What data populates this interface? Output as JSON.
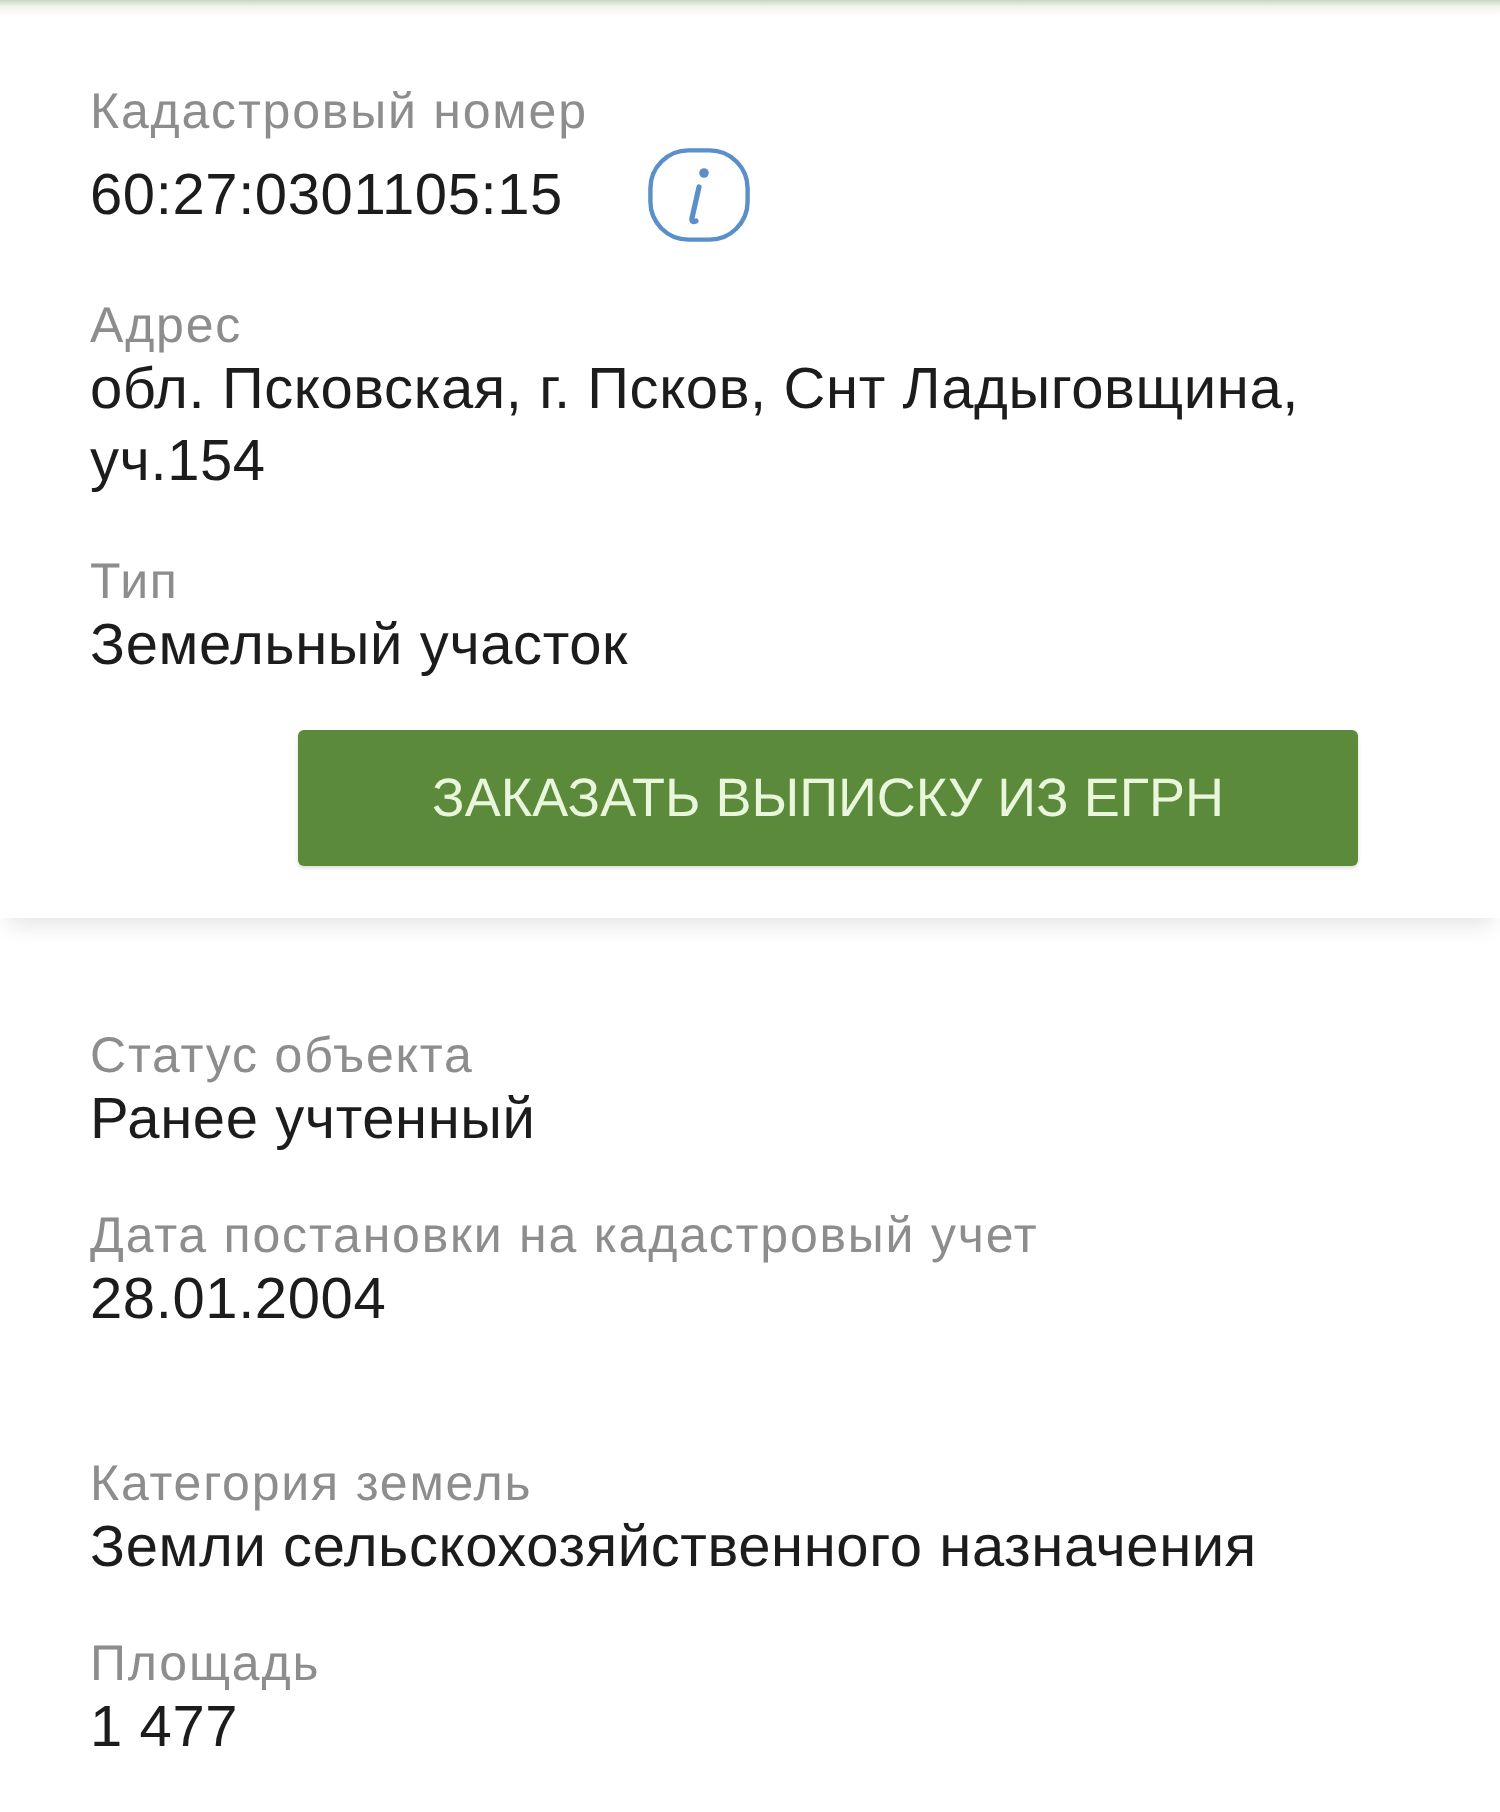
{
  "object_card": {
    "fields": [
      {
        "label": "Кадастровый номер",
        "value": "60:27:0301105:15",
        "info_button": true
      },
      {
        "label": "Адрес",
        "value": "обл. Псковская, г. Псков, Снт Ладыговщина, уч.154",
        "info_button": false
      },
      {
        "label": "Тип",
        "value": "Земельный участок",
        "info_button": false
      }
    ],
    "order_button": "ЗАКАЗАТЬ ВЫПИСКУ ИЗ ЕГРН"
  },
  "details": {
    "fields": [
      {
        "label": "Статус объекта",
        "value": "Ранее учтенный"
      },
      {
        "label": "Дата постановки на кадастровый учет",
        "value": "28.01.2004"
      },
      {
        "label": "Категория земель",
        "value": "Земли сельскохозяйственного назначения"
      },
      {
        "label": "Площадь",
        "value": "1 477"
      }
    ]
  }
}
